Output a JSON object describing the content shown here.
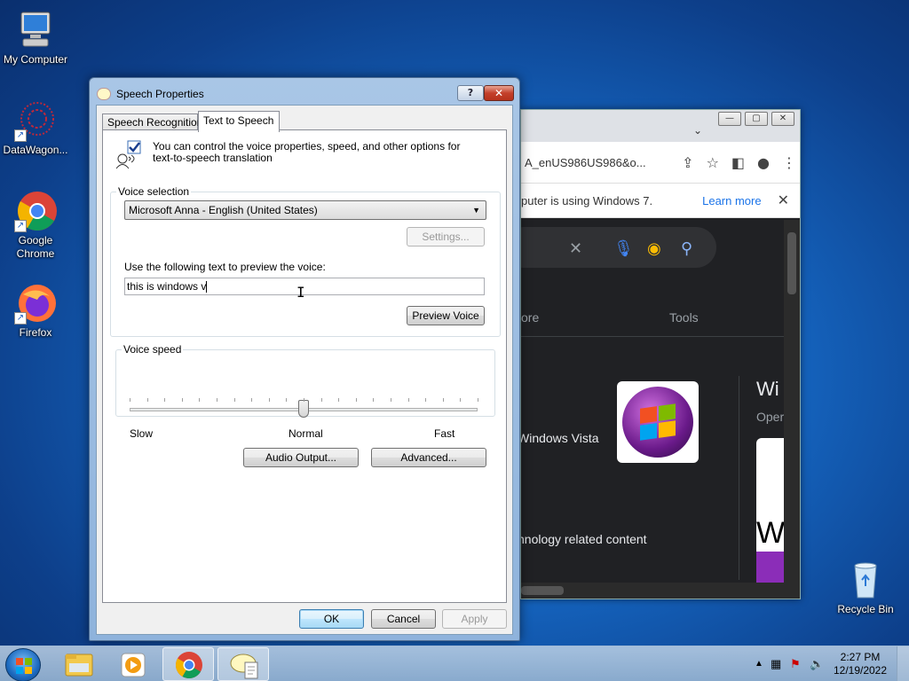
{
  "desktop": {
    "icons": [
      {
        "label": "My Computer"
      },
      {
        "label": "DataWagon..."
      },
      {
        "label": "Google Chrome"
      },
      {
        "label": "Firefox"
      },
      {
        "label": "Recycle Bin"
      }
    ]
  },
  "chrome": {
    "url_fragment": "A_enUS986US986&o...",
    "info_message": "puter is using Windows 7.",
    "learn_more": "Learn more",
    "tab_more": "ore",
    "tab_tools": "Tools",
    "result_title": "Windows Vista",
    "result_text": "hnology related content",
    "side_title": "Wi",
    "side_subtitle": "Oper"
  },
  "dialog": {
    "title": "Speech Properties",
    "help_label": "?",
    "close_label": "✕",
    "tabs": [
      {
        "label": "Speech Recognition"
      },
      {
        "label": "Text to Speech"
      }
    ],
    "intro_text": "You can control the voice properties, speed, and other options for text-to-speech translation",
    "voice_selection": {
      "label": "Voice selection",
      "selected_voice": "Microsoft Anna - English (United States)",
      "settings_button": "Settings..."
    },
    "preview": {
      "label": "Use the following text to preview the voice:",
      "text_value": "this is windows v",
      "preview_button": "Preview Voice"
    },
    "voice_speed": {
      "label": "Voice speed",
      "slow": "Slow",
      "normal": "Normal",
      "fast": "Fast",
      "position_fraction": 0.5
    },
    "audio_output_button": "Audio Output...",
    "advanced_button": "Advanced...",
    "ok_button": "OK",
    "cancel_button": "Cancel",
    "apply_button": "Apply"
  },
  "taskbar": {
    "clock_time": "2:27 PM",
    "clock_date": "12/19/2022"
  }
}
